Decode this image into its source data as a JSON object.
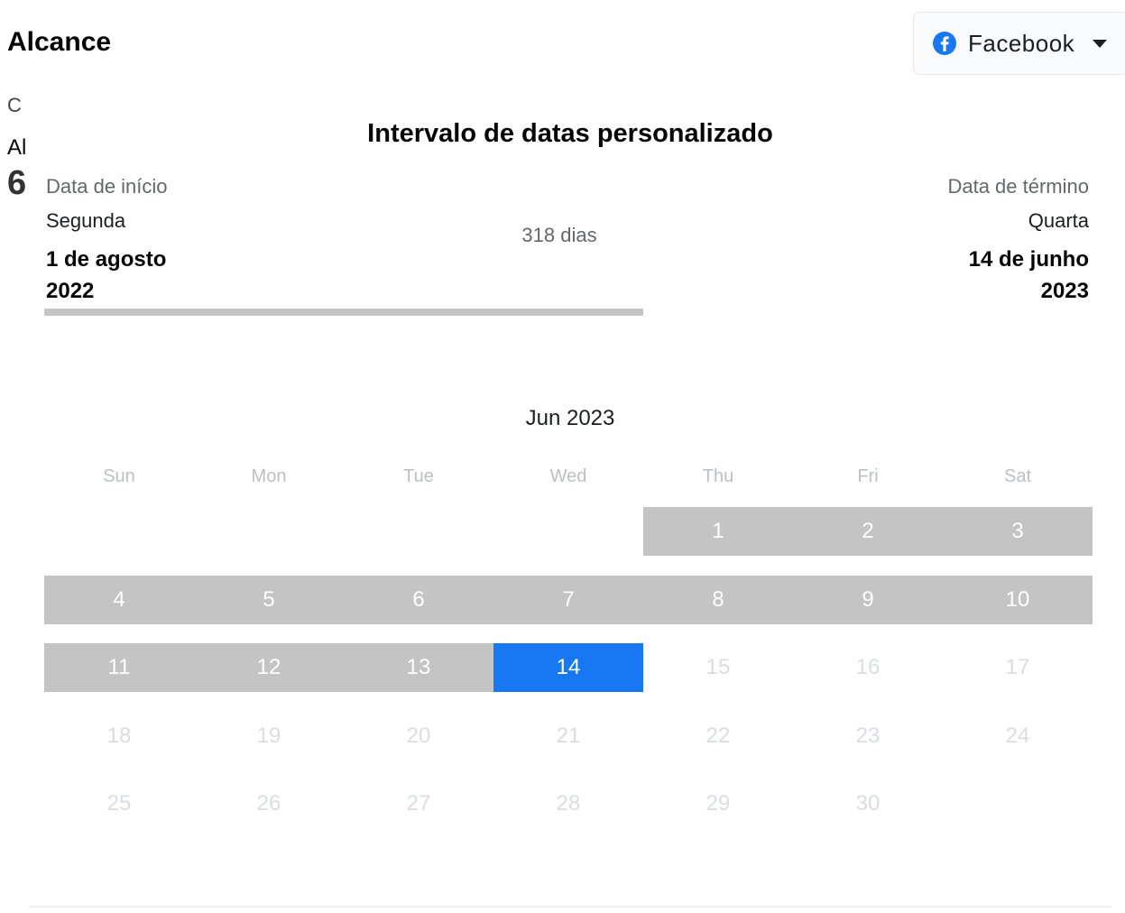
{
  "page": {
    "title": "Alcance",
    "partial_texts": [
      "C",
      "Al",
      "6"
    ]
  },
  "platform_selector": {
    "label": "Facebook",
    "icon": "facebook-icon",
    "accent": "#1877f2"
  },
  "modal": {
    "title": "Intervalo de datas personalizado",
    "start": {
      "caption": "Data de início",
      "weekday": "Segunda",
      "date_line1": "1 de agosto",
      "date_line2": "2022"
    },
    "end": {
      "caption": "Data de término",
      "weekday": "Quarta",
      "date_line1": "14 de junho",
      "date_line2": "2023"
    },
    "duration": "318 dias",
    "calendar": {
      "month_label": "Jun  2023",
      "weekdays": [
        "Sun",
        "Mon",
        "Tue",
        "Wed",
        "Thu",
        "Fri",
        "Sat"
      ],
      "weeks": [
        [
          "",
          "",
          "",
          "",
          "1",
          "2",
          "3"
        ],
        [
          "4",
          "5",
          "6",
          "7",
          "8",
          "9",
          "10"
        ],
        [
          "11",
          "12",
          "13",
          "14",
          "15",
          "16",
          "17"
        ],
        [
          "18",
          "19",
          "20",
          "21",
          "22",
          "23",
          "24"
        ],
        [
          "25",
          "26",
          "27",
          "28",
          "29",
          "30",
          ""
        ]
      ],
      "in_range_through": 13,
      "selected_day": 14,
      "range_color": "#c4c4c4",
      "selected_color": "#1877f2"
    }
  }
}
